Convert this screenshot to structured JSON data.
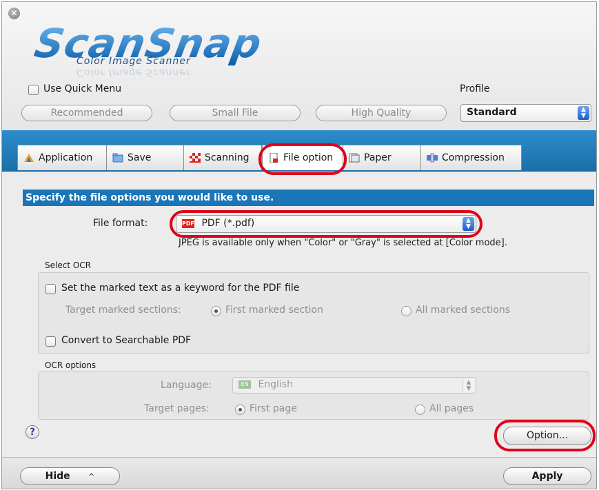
{
  "close_glyph": "✕",
  "logo": {
    "title": "ScanSnap",
    "subtitle": "Color Image Scanner"
  },
  "quick_menu": {
    "label": "Use Quick Menu",
    "checked": false
  },
  "preset_buttons": [
    "Recommended",
    "Small File",
    "High Quality"
  ],
  "profile": {
    "label": "Profile",
    "value": "Standard"
  },
  "tabs": [
    {
      "label": "Application",
      "icon": "application-icon"
    },
    {
      "label": "Save",
      "icon": "folder-icon"
    },
    {
      "label": "Scanning",
      "icon": "scanning-icon"
    },
    {
      "label": "File option",
      "icon": "file-icon",
      "selected": true
    },
    {
      "label": "Paper",
      "icon": "paper-icon"
    },
    {
      "label": "Compression",
      "icon": "compression-icon"
    }
  ],
  "instruction": "Specify the file options you would like to use.",
  "file_format": {
    "label": "File format:",
    "value": "PDF (*.pdf)",
    "badge": "PDF",
    "note": "JPEG is available only when \"Color\" or \"Gray\" is selected at [Color mode]."
  },
  "select_ocr": {
    "label": "Select OCR",
    "keyword_checkbox": "Set the marked text as a keyword for the PDF file",
    "target_label": "Target marked sections:",
    "target_options": [
      "First marked section",
      "All marked sections"
    ],
    "searchable_checkbox": "Convert to Searchable PDF"
  },
  "ocr_options": {
    "label": "OCR options",
    "language_label": "Language:",
    "language_value": "English",
    "language_badge": "EN",
    "pages_label": "Target pages:",
    "pages_options": [
      "First page",
      "All pages"
    ]
  },
  "help_glyph": "?",
  "option_button": "Option...",
  "hide_button": "Hide",
  "hide_chevron": "^",
  "apply_button": "Apply",
  "colors": {
    "accent_blue": "#1a76b8",
    "highlight_red": "#e0001b",
    "logo_blue": "#1e6fc0"
  }
}
